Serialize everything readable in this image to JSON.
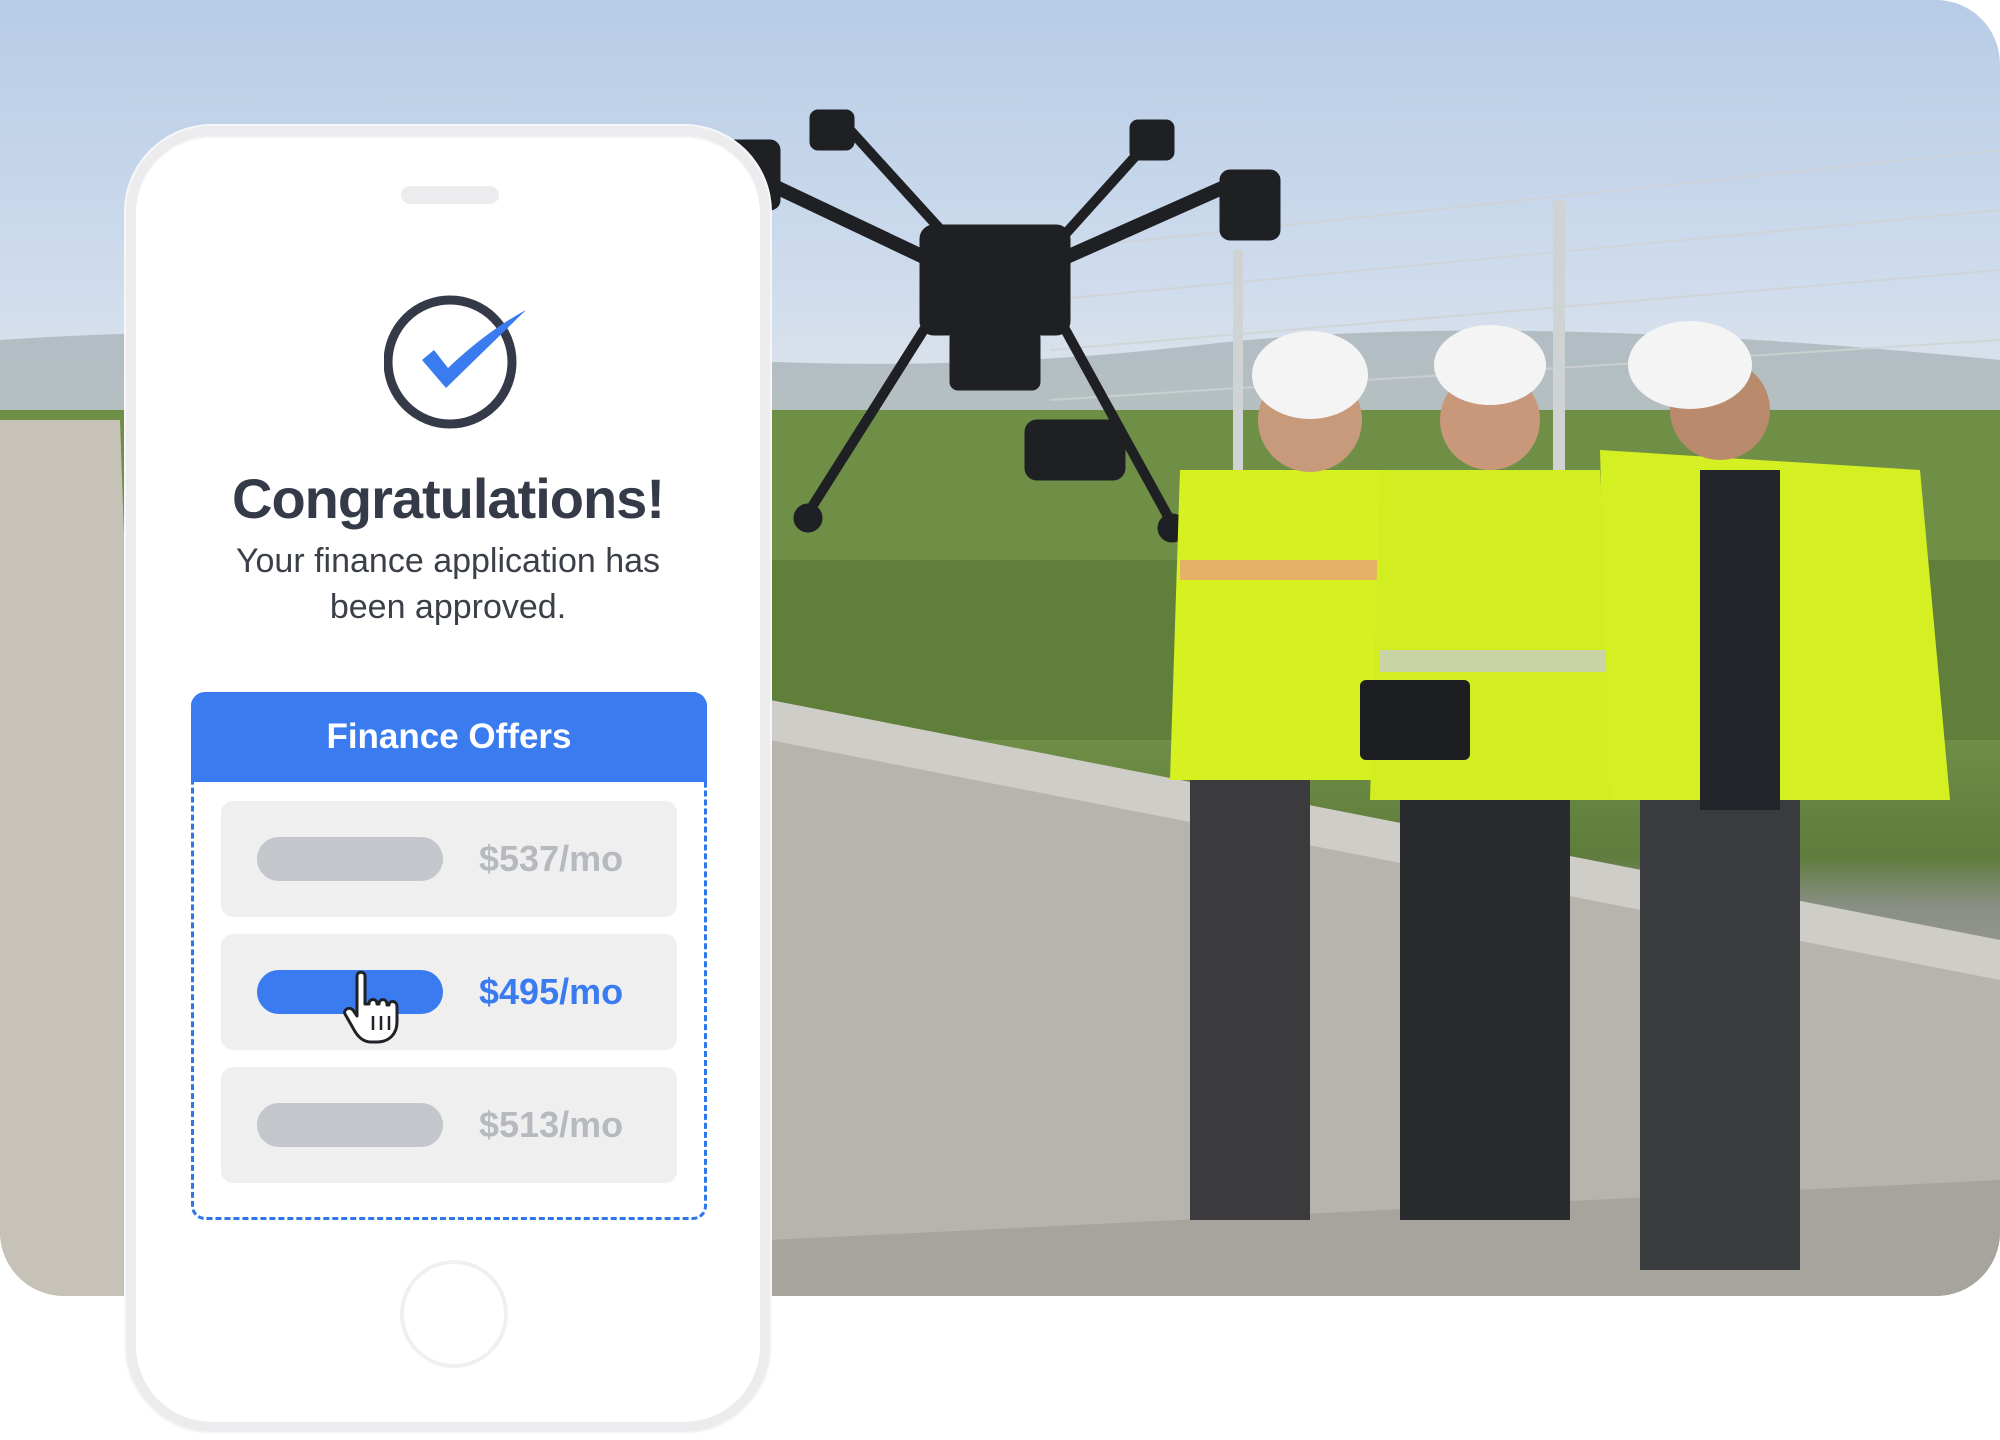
{
  "card": {
    "title": "Congratulations!",
    "subtitle": "Your finance application has been approved.",
    "offers_header": "Finance Offers",
    "offers": [
      {
        "price": "$537/mo",
        "selected": false
      },
      {
        "price": "$495/mo",
        "selected": true
      },
      {
        "price": "$513/mo",
        "selected": false
      }
    ]
  },
  "colors": {
    "accent": "#3a7bf0",
    "title_text": "#343a47",
    "muted_price": "#b6babe",
    "row_background": "#efeff0"
  },
  "icons": [
    "check-circle-icon",
    "pointer-hand-icon"
  ]
}
